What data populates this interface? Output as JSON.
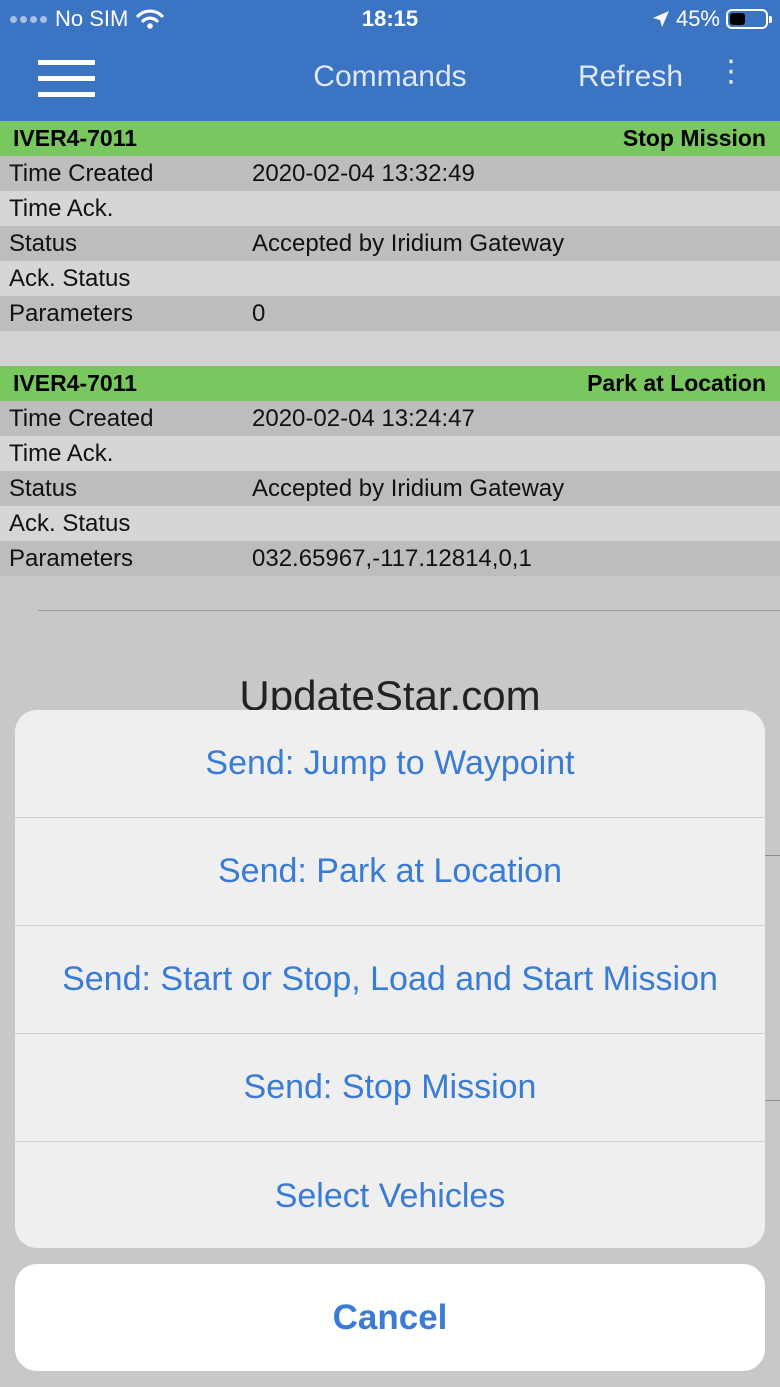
{
  "status_bar": {
    "carrier": "No SIM",
    "time": "18:15",
    "battery_percent": "45%",
    "battery_level": 0.45,
    "icons": [
      "signal-dots-icon",
      "wifi-icon",
      "location-arrow-icon",
      "battery-icon"
    ]
  },
  "navbar": {
    "title": "Commands",
    "refresh_label": "Refresh",
    "more_glyph": "⋮",
    "menu_icon": "hamburger-icon"
  },
  "commands": [
    {
      "vehicle": "IVER4-7011",
      "command": "Stop Mission",
      "fields": [
        {
          "label": "Time Created",
          "value": "2020-02-04 13:32:49"
        },
        {
          "label": "Time Ack.",
          "value": ""
        },
        {
          "label": "Status",
          "value": "Accepted by Iridium Gateway"
        },
        {
          "label": "Ack. Status",
          "value": ""
        },
        {
          "label": "Parameters",
          "value": "0"
        }
      ]
    },
    {
      "vehicle": "IVER4-7011",
      "command": "Park at Location",
      "fields": [
        {
          "label": "Time Created",
          "value": "2020-02-04 13:24:47"
        },
        {
          "label": "Time Ack.",
          "value": ""
        },
        {
          "label": "Status",
          "value": "Accepted by Iridium Gateway"
        },
        {
          "label": "Ack. Status",
          "value": ""
        },
        {
          "label": "Parameters",
          "value": "032.65967,-117.12814,0,1"
        }
      ]
    }
  ],
  "watermark": "UpdateStar.com",
  "action_sheet": {
    "items": [
      "Send: Jump to Waypoint",
      "Send: Park at Location",
      "Send: Start or Stop, Load and Start Mission",
      "Send: Stop Mission",
      "Select Vehicles"
    ],
    "cancel_label": "Cancel"
  },
  "colors": {
    "nav_blue": "#3a74c2",
    "header_green": "#78c85f",
    "action_blue": "#3a7bd5"
  }
}
